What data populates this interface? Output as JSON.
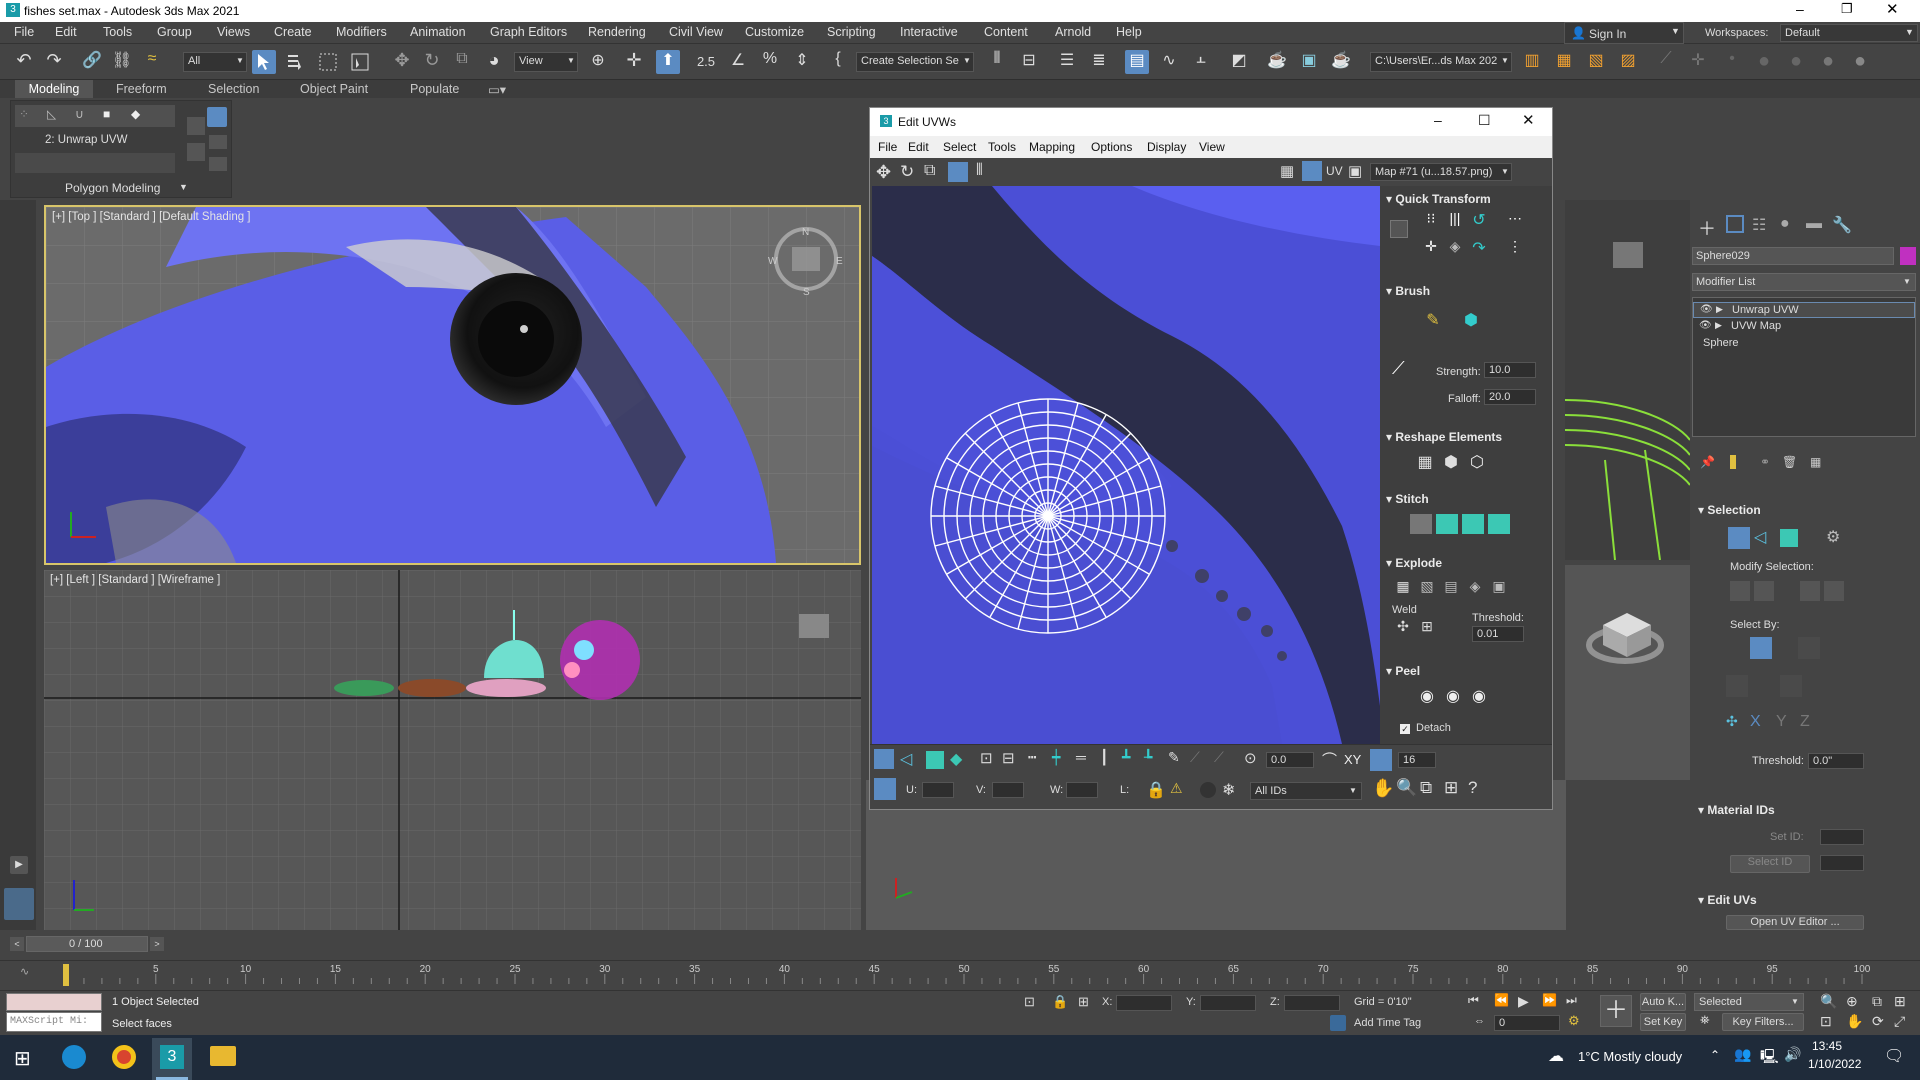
{
  "window": {
    "title": "fishes set.max - Autodesk 3ds Max 2021"
  },
  "menu": [
    "File",
    "Edit",
    "Tools",
    "Group",
    "Views",
    "Create",
    "Modifiers",
    "Animation",
    "Graph Editors",
    "Rendering",
    "Civil View",
    "Customize",
    "Scripting",
    "Interactive",
    "Content",
    "Arnold",
    "Help"
  ],
  "account": {
    "signin": "Sign In",
    "workspaces_label": "Workspaces:",
    "workspace": "Default"
  },
  "toolbar": {
    "filter": "All",
    "refcoord": "View",
    "selection_set": "Create Selection Se",
    "path": "C:\\Users\\Er...ds Max 202"
  },
  "ribbon": {
    "tabs": [
      "Modeling",
      "Freeform",
      "Selection",
      "Object Paint",
      "Populate"
    ],
    "sub_label": "2: Unwrap UVW",
    "poly_label": "Polygon Modeling"
  },
  "viewports": {
    "top": {
      "label": "[+] [Top ] [Standard ] [Default Shading ]",
      "compass": [
        "N",
        "W",
        "E",
        "S"
      ]
    },
    "left": {
      "label": "[+] [Left ] [Standard ] [Wireframe ]"
    }
  },
  "uv_editor": {
    "title": "Edit UVWs",
    "menu": [
      "File",
      "Edit",
      "Select",
      "Tools",
      "Mapping",
      "Options",
      "Display",
      "View"
    ],
    "uv_label": "UV",
    "map": "Map #71 (u...18.57.png)",
    "panel": {
      "quick_transform": "Quick Transform",
      "brush": "Brush",
      "strength_label": "Strength:",
      "strength": "10.0",
      "falloff_label": "Falloff:",
      "falloff": "20.0",
      "reshape": "Reshape Elements",
      "stitch": "Stitch",
      "explode": "Explode",
      "weld": "Weld",
      "threshold_label": "Threshold:",
      "threshold": "0.01",
      "peel": "Peel",
      "detach": "Detach"
    },
    "bottom": {
      "rotate_val": "0.0",
      "xy": "XY",
      "grid_val": "16",
      "u_label": "U:",
      "v_label": "V:",
      "w_label": "W:",
      "l_label": "L:",
      "ids": "All IDs"
    }
  },
  "command_panel": {
    "object_name": "Sphere029",
    "modifier_list": "Modifier List",
    "stack": [
      "Unwrap UVW",
      "UVW Map",
      "Sphere"
    ],
    "selection": "Selection",
    "modify_selection": "Modify Selection:",
    "select_by": "Select By:",
    "threshold_label": "Threshold:",
    "threshold": "0.0\"",
    "material_ids": "Material IDs",
    "set_id": "Set ID:",
    "select_id": "Select ID",
    "edit_uvs": "Edit UVs",
    "open_uv_editor": "Open UV Editor ..."
  },
  "timeline": {
    "frame": "0 / 100",
    "ticks": [
      "0",
      "5",
      "10",
      "15",
      "20",
      "25",
      "30",
      "35",
      "40",
      "45",
      "50",
      "55",
      "60",
      "65",
      "70",
      "75",
      "80",
      "85",
      "90",
      "95",
      "100"
    ]
  },
  "status": {
    "maxscript": "MAXScript Mi:",
    "selected": "1 Object Selected",
    "prompt": "Select faces",
    "x_label": "X:",
    "y_label": "Y:",
    "z_label": "Z:",
    "grid": "Grid = 0'10\"",
    "add_time_tag": "Add Time Tag",
    "auto_key": "Auto K...",
    "set_key": "Set Key",
    "selected_dd": "Selected",
    "key_filters": "Key Filters...",
    "frame_field": "0"
  },
  "taskbar": {
    "weather": "1°C  Mostly cloudy",
    "time": "13:45",
    "date": "1/10/2022"
  }
}
